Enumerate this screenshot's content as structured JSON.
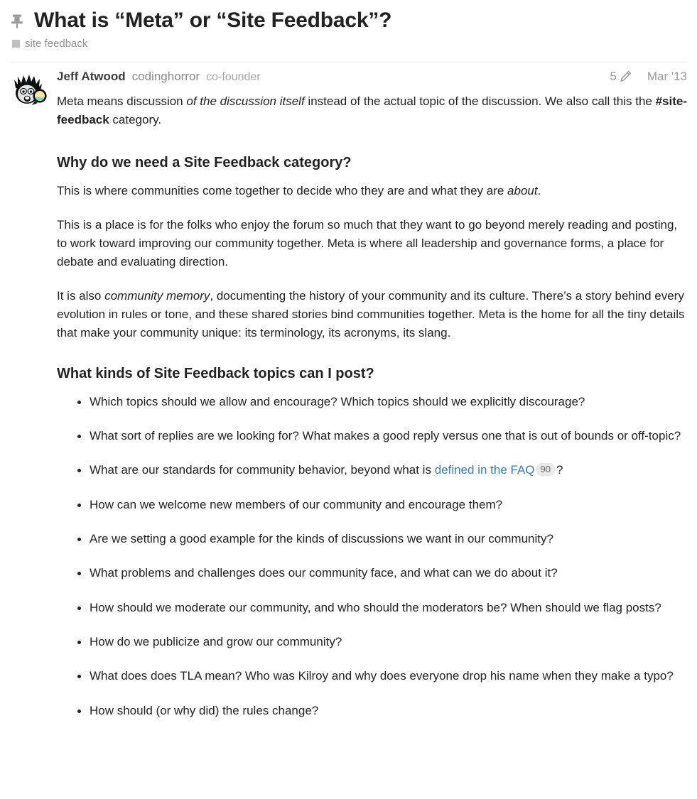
{
  "header": {
    "pin_icon": "pin-icon",
    "title": "What is “Meta” or “Site Feedback”?",
    "category": {
      "name": "site feedback",
      "color": "#bfbfbf"
    }
  },
  "post": {
    "avatar_alt": "codinghorror-avatar",
    "author": {
      "full_name": "Jeff Atwood",
      "username": "codinghorror",
      "user_title": "co-founder"
    },
    "edit_count": "5",
    "edit_icon": "pencil-icon",
    "date": "Mar '13",
    "content": {
      "p1": {
        "a": "Meta means discussion ",
        "em1": "of the discussion itself",
        "b": " instead of the actual topic of the discussion. We also call this the ",
        "strong1": "#site-feedback",
        "c": " category."
      },
      "h2_1": "Why do we need a Site Feedback category?",
      "p2": {
        "a": "This is where communities come together to decide who they are and what they are ",
        "em1": "about",
        "b": "."
      },
      "p3": "This is a place is for the folks who enjoy the forum so much that they want to go beyond merely reading and posting, to work toward improving our community together. Meta is where all leadership and governance forms, a place for debate and evaluating direction.",
      "p4": {
        "a": "It is also ",
        "em1": "community memory",
        "b": ", documenting the history of your community and its culture. There’s a story behind every evolution in rules or tone, and these shared stories bind communities together. Meta is the home for all the tiny details that make your community unique: its terminology, its acronyms, its slang."
      },
      "h2_2": "What kinds of Site Feedback topics can I post?",
      "list": {
        "item1": "Which topics should we allow and encourage? Which topics should we explicitly discourage?",
        "item2": "What sort of replies are we looking for? What makes a good reply versus one that is out of bounds or off-topic?",
        "item3": {
          "a": "What are our standards for community behavior, beyond what is ",
          "link_text": "defined in the FAQ",
          "badge": "90",
          "b": "?"
        },
        "item4": "How can we welcome new members of our community and encourage them?",
        "item5": "Are we setting a good example for the kinds of discussions we want in our community?",
        "item6": "What problems and challenges does our community face, and what can we do about it?",
        "item7": "How should we moderate our community, and who should the moderators be? When should we flag posts?",
        "item8": "How do we publicize and grow our community?",
        "item9": "What does does TLA mean? Who was Kilroy and why does everyone drop his name when they make a typo?",
        "item10": "How should (or why did) the rules change?"
      }
    }
  },
  "colors": {
    "link": "#3b7ea8",
    "text": "#222222",
    "muted": "#999999",
    "badge_bg": "#e9e9e9"
  }
}
